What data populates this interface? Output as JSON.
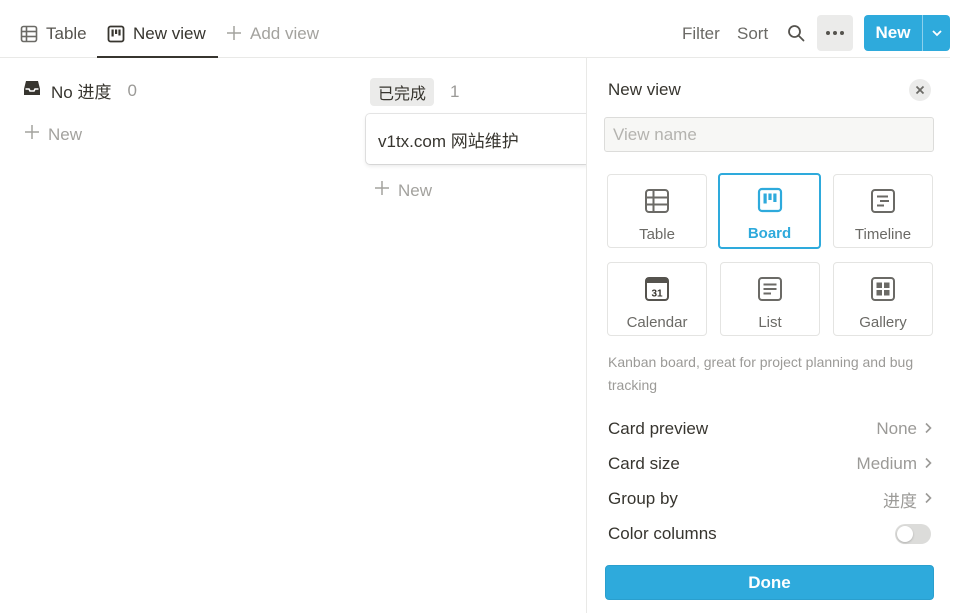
{
  "toolbar": {
    "tabs": [
      {
        "label": "Table",
        "icon": "table-icon"
      },
      {
        "label": "New view",
        "icon": "board-icon",
        "active": true
      },
      {
        "label": "Add view",
        "icon": "plus-icon"
      }
    ],
    "filter_label": "Filter",
    "sort_label": "Sort",
    "new_label": "New"
  },
  "board": {
    "columns": [
      {
        "title": "No 进度",
        "count": "0",
        "add_label": "New"
      },
      {
        "title": "已完成",
        "count": "1",
        "add_label": "New",
        "cards": [
          "v1tx.com 网站维护"
        ]
      }
    ]
  },
  "panel": {
    "title": "New view",
    "name_placeholder": "View name",
    "view_types": [
      {
        "label": "Table",
        "icon": "table-icon"
      },
      {
        "label": "Board",
        "icon": "board-icon",
        "selected": true
      },
      {
        "label": "Timeline",
        "icon": "timeline-icon"
      },
      {
        "label": "Calendar",
        "icon": "calendar-icon",
        "icon_text": "31"
      },
      {
        "label": "List",
        "icon": "list-icon"
      },
      {
        "label": "Gallery",
        "icon": "gallery-icon"
      }
    ],
    "description": "Kanban board, great for project planning and bug tracking",
    "options": [
      {
        "label": "Card preview",
        "value": "None"
      },
      {
        "label": "Card size",
        "value": "Medium"
      },
      {
        "label": "Group by",
        "value": "进度"
      },
      {
        "label": "Color columns",
        "value": false
      }
    ],
    "done_label": "Done"
  },
  "colors": {
    "accent": "#2eaadc",
    "text": "#37352f",
    "muted": "#9b9a97"
  }
}
